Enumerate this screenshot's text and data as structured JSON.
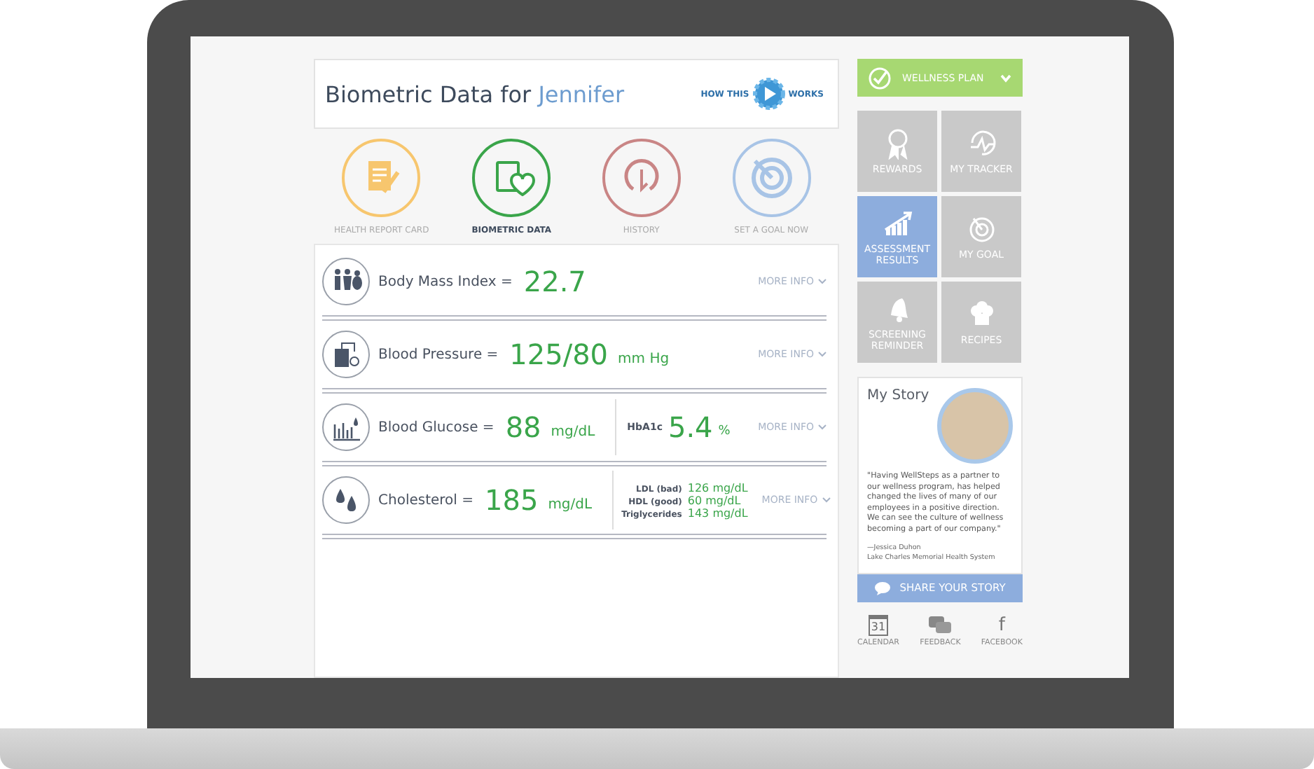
{
  "header": {
    "title": "Biometric Data for ",
    "name": "Jennifer",
    "how_it_works": [
      "HOW THIS",
      "WORKS"
    ]
  },
  "nav": [
    {
      "label": "HEALTH REPORT CARD",
      "selected": false,
      "color": "#f7c66e"
    },
    {
      "label": "BIOMETRIC DATA",
      "selected": true,
      "color": "#3aa54a"
    },
    {
      "label": "HISTORY",
      "selected": false,
      "color": "#c98585"
    },
    {
      "label": "SET A GOAL NOW",
      "selected": false,
      "color": "#a8c4e6"
    }
  ],
  "metrics": [
    {
      "kind": "single",
      "label": "Body Mass Index =",
      "value": "22.7",
      "more": "MORE INFO"
    },
    {
      "kind": "single",
      "label": "Blood Pressure =",
      "value": "125/80",
      "unit": "mm Hg",
      "more": "MORE INFO"
    },
    {
      "kind": "split",
      "label": "Blood Glucose =",
      "value": "88",
      "unit": "mg/dL",
      "side_label": "HbA1c",
      "side_value": "5.4",
      "side_unit": "%",
      "more": "MORE INFO"
    },
    {
      "kind": "list",
      "label": "Cholesterol =",
      "value": "185",
      "unit": "mg/dL",
      "more": "MORE INFO",
      "sub": [
        {
          "label": "LDL (bad)",
          "value": "126 mg/dL"
        },
        {
          "label": "HDL (good)",
          "value": "60 mg/dL"
        },
        {
          "label": "Triglycerides",
          "value": "143 mg/dL"
        }
      ]
    }
  ],
  "sidebar": {
    "plan": "WELLNESS PLAN",
    "tiles": [
      {
        "label": "REWARDS",
        "selected": false
      },
      {
        "label": "MY TRACKER",
        "selected": false
      },
      {
        "label": "ASSESSMENT RESULTS",
        "selected": true
      },
      {
        "label": "MY GOAL",
        "selected": false
      },
      {
        "label": "SCREENING REMINDER",
        "selected": false
      },
      {
        "label": "RECIPES",
        "selected": false
      }
    ],
    "story": {
      "title": "My Story",
      "quote": "\"Having WellSteps as a partner to our wellness program, has helped changed the lives of many of our employees in a positive direction. We can see the culture of wellness becoming a part of our company.\"",
      "author": "—Jessica Duhon",
      "org": "Lake Charles Memorial Health System"
    },
    "share": "SHARE YOUR STORY",
    "links": [
      {
        "label": "CALENDAR",
        "day": "31"
      },
      {
        "label": "FEEDBACK"
      },
      {
        "label": "FACEBOOK",
        "glyph": "f"
      }
    ]
  }
}
